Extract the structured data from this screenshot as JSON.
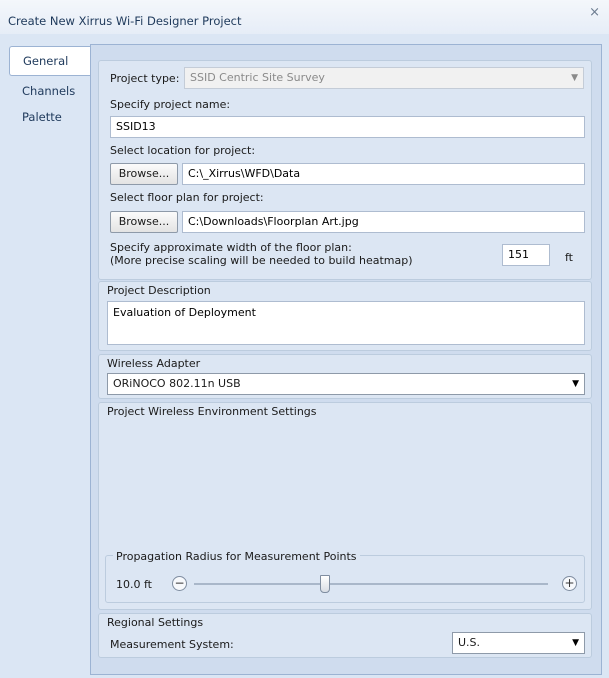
{
  "window": {
    "title": "Create New Xirrus Wi-Fi Designer Project",
    "close_glyph": "×"
  },
  "tabs": [
    {
      "label": "General"
    },
    {
      "label": "Channels"
    },
    {
      "label": "Palette"
    }
  ],
  "general": {
    "project_type_label": "Project type:",
    "project_type_value": "SSID Centric Site Survey",
    "project_name_label": "Specify project name:",
    "project_name_value": "SSID13",
    "location_label": "Select location for project:",
    "location_browse": "Browse...",
    "location_value": "C:\\_Xirrus\\WFD\\Data",
    "floorplan_label": "Select floor plan for project:",
    "floorplan_browse": "Browse...",
    "floorplan_value": "C:\\Downloads\\Floorplan Art.jpg",
    "width_label_line1": "Specify approximate width of the floor plan:",
    "width_label_line2": "(More precise scaling will be needed to build heatmap)",
    "width_value": "151",
    "width_unit": "ft"
  },
  "description": {
    "title": "Project Description",
    "value": "Evaluation of Deployment"
  },
  "adapter": {
    "title": "Wireless Adapter",
    "value": "ORiNOCO 802.11n USB"
  },
  "environment": {
    "title": "Project Wireless Environment Settings"
  },
  "propagation": {
    "title": "Propagation Radius for Measurement Points",
    "value": "10.0 ft",
    "level_fraction": 0.37,
    "minus": "−",
    "plus": "+"
  },
  "regional": {
    "title": "Regional Settings",
    "system_label": "Measurement System:",
    "system_value": "U.S."
  },
  "colors": {
    "accent": "#9cb3d3",
    "background": "#dbe6f4"
  }
}
